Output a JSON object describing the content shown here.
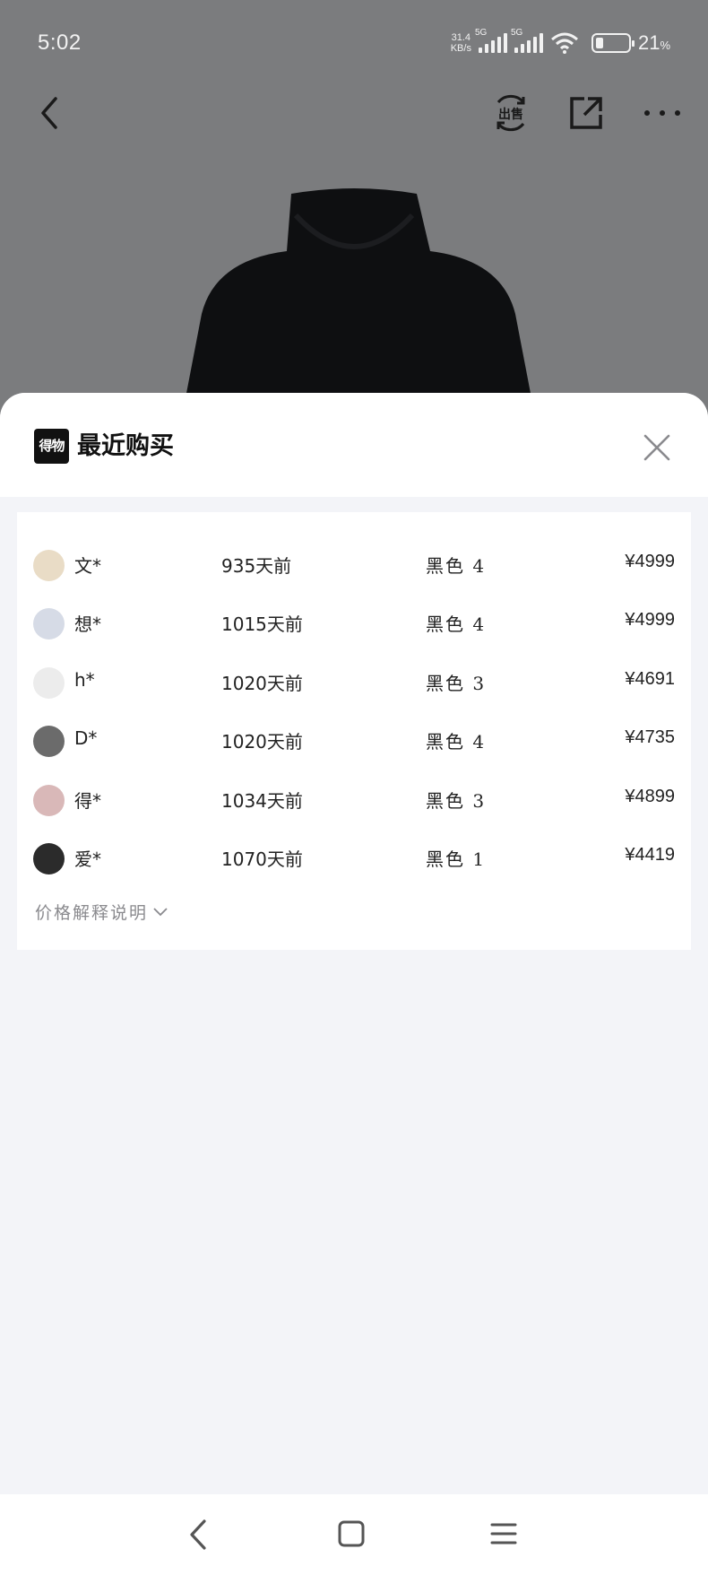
{
  "status_bar": {
    "time": "5:02",
    "net_speed_value": "31.4",
    "net_speed_unit": "KB/s",
    "signal1_tag": "5G",
    "signal2_tag": "5G",
    "battery_percent": "21",
    "battery_unit": "%",
    "battery_level": 0.21
  },
  "top_nav": {
    "sell_label": "出售",
    "icons": [
      "back-icon",
      "sell-icon",
      "share-icon",
      "more-icon"
    ]
  },
  "sheet": {
    "brand_logo_text": "得物",
    "title": "最近购买",
    "purchases": [
      {
        "buyer": "文*",
        "time_ago": "935天前",
        "spec": "黑色 4",
        "price": "¥4999",
        "avatar_color": "#e9dcc6"
      },
      {
        "buyer": "想*",
        "time_ago": "1015天前",
        "spec": "黑色 4",
        "price": "¥4999",
        "avatar_color": "#d6dbe6"
      },
      {
        "buyer": "h*",
        "time_ago": "1020天前",
        "spec": "黑色 3",
        "price": "¥4691",
        "avatar_color": "#ececec"
      },
      {
        "buyer": "D*",
        "time_ago": "1020天前",
        "spec": "黑色 4",
        "price": "¥4735",
        "avatar_color": "#6b6b6b"
      },
      {
        "buyer": "得*",
        "time_ago": "1034天前",
        "spec": "黑色 3",
        "price": "¥4899",
        "avatar_color": "#d9b8b8"
      },
      {
        "buyer": "爱*",
        "time_ago": "1070天前",
        "spec": "黑色 1",
        "price": "¥4419",
        "avatar_color": "#2b2b2b"
      }
    ],
    "price_note": "价格解释说明"
  },
  "colors": {
    "backdrop": "#7b7c7e",
    "sheet_bg": "#f3f4f8",
    "card_bg": "#ffffff",
    "muted_text": "#8a8a8e"
  }
}
